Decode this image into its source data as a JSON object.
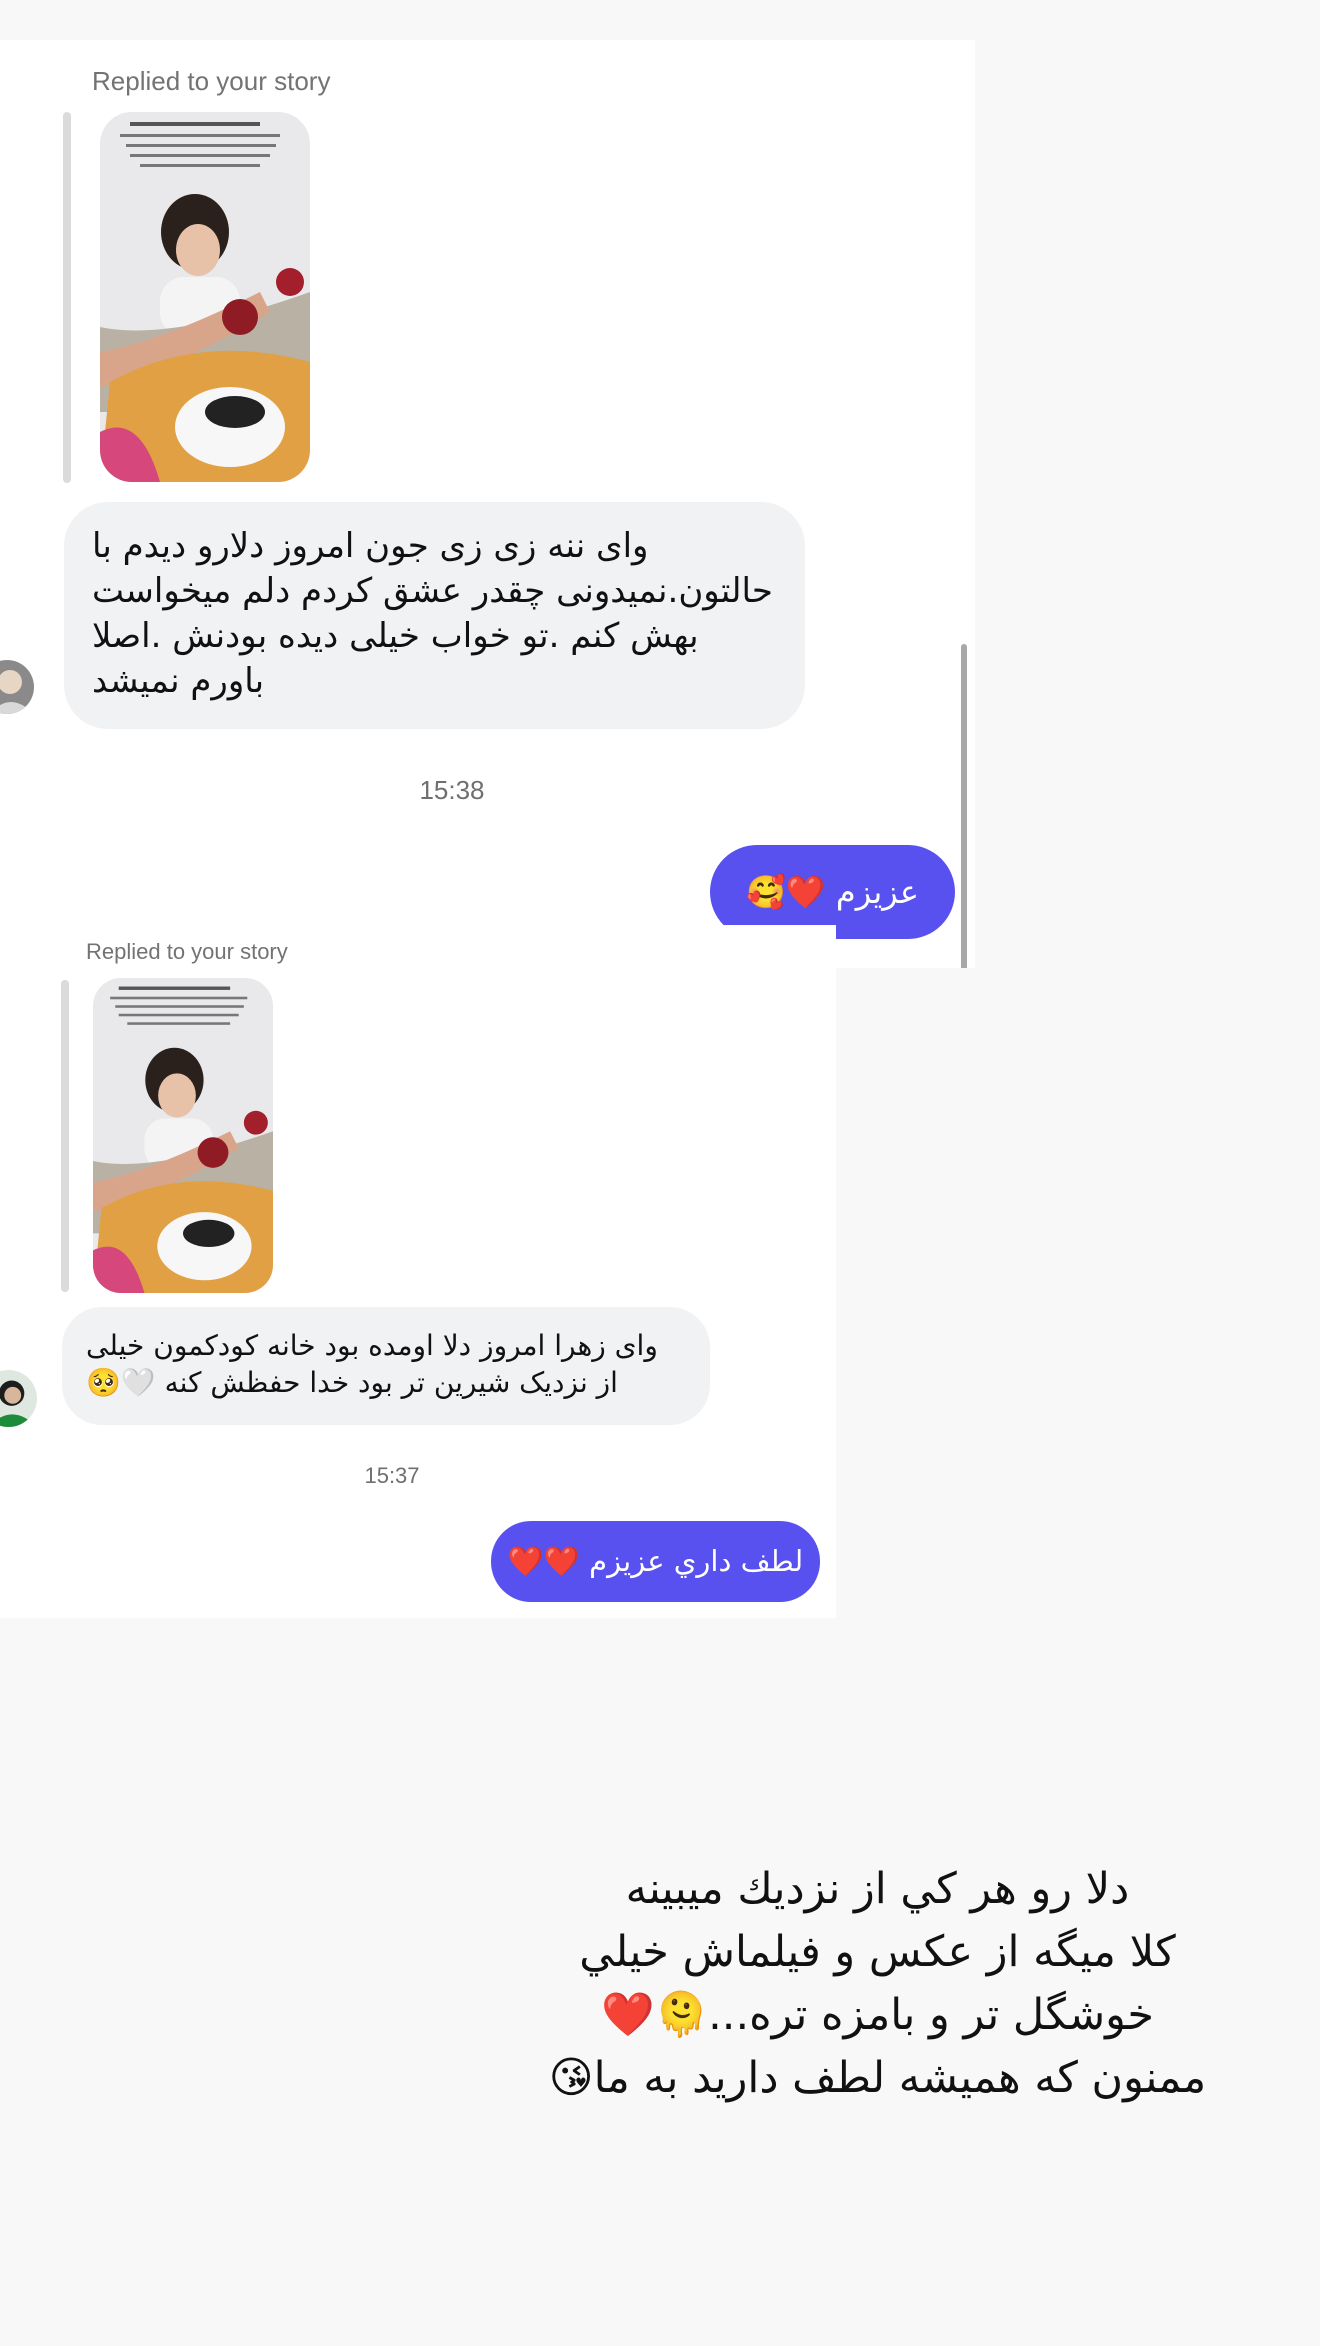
{
  "screenshot_top": {
    "replied_label": "Replied to your story",
    "incoming_message": "وای ننه زی زی جون امروز  دلارو دیدم با حالتون.نمیدونی چقدر عشق کردم دلم میخواست بهش کنم .تو خواب خیلی دیده بودنش .اصلا باورم نمیشد",
    "timestamp": "15:38",
    "outgoing_message": "عزیزم ❤️🥰"
  },
  "screenshot_bottom": {
    "replied_label": "Replied to your story",
    "incoming_message": "وای زهرا امروز دلا اومده بود خانه کودکمون خیلی از نزدیک شیرین تر بود خدا حفظش کنه 🤍🥺",
    "timestamp": "15:37",
    "outgoing_message": "لطف داري عزيزم ❤️❤️"
  },
  "caption": {
    "text": "دلا رو هر كي از نزديك ميبينه\nكلا ميگه از عكس و فيلماش خيلي\nخوشگل تر و بامزه تره...🫠❤️\nممنون كه هميشه لطف داريد به ما😘"
  },
  "colors": {
    "outgoing_bubble": "#5851f0",
    "incoming_bubble": "#f1f2f4",
    "page_background": "#f8f8f8"
  }
}
